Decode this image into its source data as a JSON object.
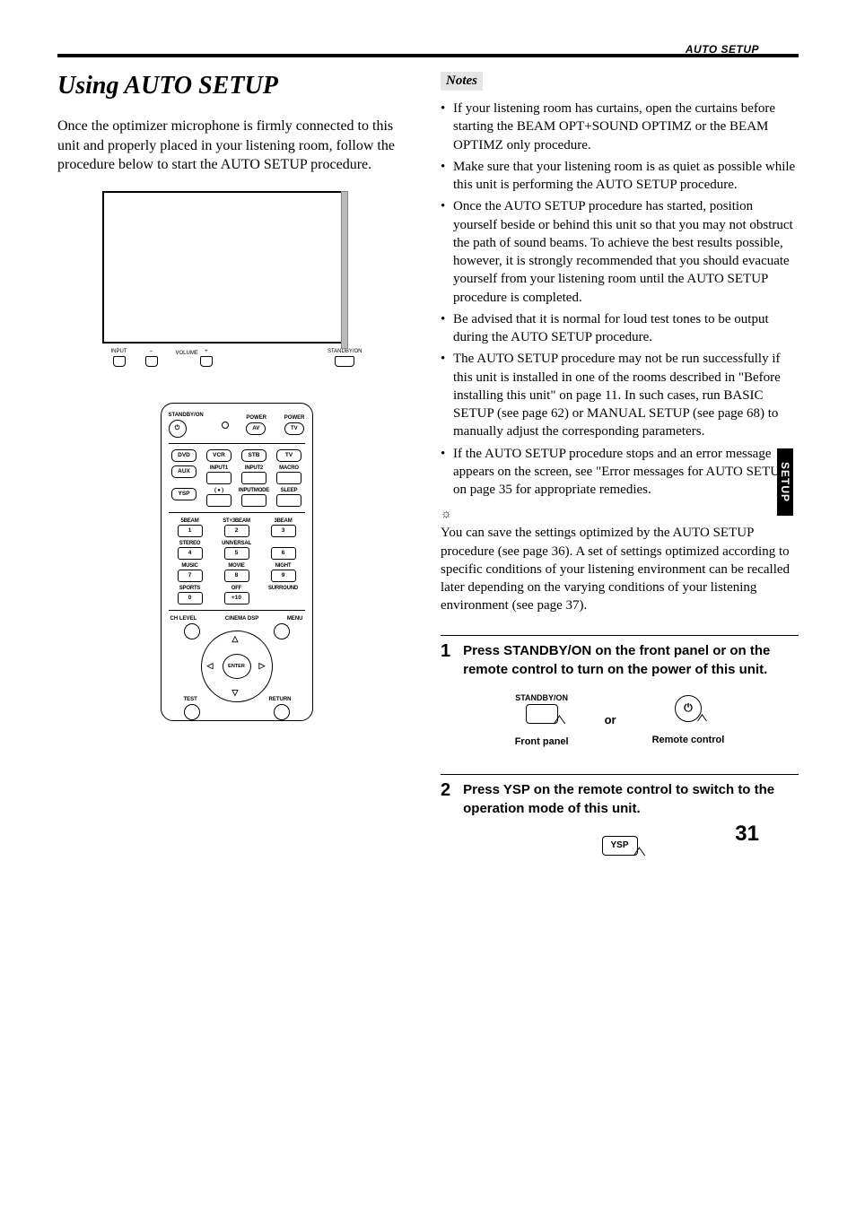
{
  "header": {
    "tag": "AUTO SETUP"
  },
  "sidetab": "SETUP",
  "page_number": "31",
  "title": "Using AUTO SETUP",
  "intro": "Once the optimizer microphone is firmly connected to this unit and properly placed in your listening room, follow the procedure below to start the AUTO SETUP procedure.",
  "device": {
    "input": "INPUT",
    "vol_minus": "–",
    "volume": "VOLUME",
    "vol_plus": "+",
    "standby": "STANDBY/ON"
  },
  "remote": {
    "standby_on": "STANDBY/ON",
    "power": "POWER",
    "av": "AV",
    "tv": "TV",
    "dvd": "DVD",
    "vcr": "VCR",
    "stb": "STB",
    "tv2": "TV",
    "input1": "INPUT1",
    "input2": "INPUT2",
    "macro": "MACRO",
    "aux": "AUX",
    "rec_dot": "( ● )",
    "inputmode": "INPUTMODE",
    "sleep": "SLEEP",
    "ysp": "YSP",
    "fivebeam": "5BEAM",
    "st3beam": "ST+3BEAM",
    "threebeam": "3BEAM",
    "n1": "1",
    "n2": "2",
    "n3": "3",
    "stereo": "STEREO",
    "universal": "UNIVERSAL",
    "n4": "4",
    "n5": "5",
    "n6": "6",
    "music": "MUSIC",
    "movie": "MOVIE",
    "night": "NIGHT",
    "n7": "7",
    "n8": "8",
    "n9": "9",
    "sports": "SPORTS",
    "off": "OFF",
    "surround": "SURROUND",
    "n0": "0",
    "p10": "+10",
    "chlevel": "CH LEVEL",
    "cinema": "CINEMA DSP",
    "menu": "MENU",
    "enter": "ENTER",
    "test": "TEST",
    "return": "RETURN"
  },
  "notes_head": "Notes",
  "notes": [
    "If your listening room has curtains, open the curtains before starting the BEAM OPT+SOUND OPTIMZ or the BEAM OPTIMZ only procedure.",
    "Make sure that your listening room is as quiet as possible while this unit is performing the AUTO SETUP procedure.",
    "Once the AUTO SETUP procedure has started, position yourself beside or behind this unit so that you may not obstruct the path of sound beams. To achieve the best results possible, however, it is strongly recommended that you should evacuate yourself from your listening room until the AUTO SETUP procedure is completed.",
    "Be advised that it is normal for loud test tones to be output during the AUTO SETUP procedure.",
    "The AUTO SETUP procedure may not be run successfully if this unit is installed in one of the rooms described in \"Before installing this unit\" on page 11. In such cases, run BASIC SETUP (see page 62) or MANUAL SETUP (see page 68) to manually adjust the corresponding parameters.",
    "If the AUTO SETUP procedure stops and an error message appears on the screen, see \"Error messages for AUTO SETUP\" on page 35 for appropriate remedies."
  ],
  "tip_icon": "☼",
  "tip": "You can save the settings optimized by the AUTO SETUP procedure (see page 36). A set of settings optimized according to specific conditions of your listening environment can be recalled later depending on the varying conditions of your listening environment (see page 37).",
  "steps": [
    {
      "num": "1",
      "text": "Press STANDBY/ON on the front panel or on the remote control to turn on the power of this unit."
    },
    {
      "num": "2",
      "text": "Press YSP on the remote control to switch to the operation mode of this unit."
    }
  ],
  "step1_diagram": {
    "standby_on": "STANDBY/ON",
    "front_panel": "Front panel",
    "or": "or",
    "remote_control": "Remote control",
    "power_glyph": "⏻"
  },
  "step2_diagram": {
    "ysp": "YSP"
  }
}
